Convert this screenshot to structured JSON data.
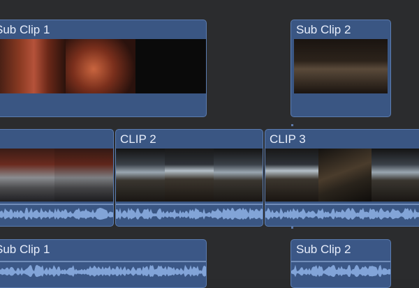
{
  "clips": {
    "top_left": {
      "title": "Sub Clip 1"
    },
    "top_right": {
      "title": "Sub Clip 2"
    },
    "main_1": {
      "title": ""
    },
    "main_2": {
      "title": "CLIP 2"
    },
    "main_3": {
      "title": "CLIP 3"
    },
    "bottom_left": {
      "title": "Sub Clip 1"
    },
    "bottom_right": {
      "title": "Sub Clip 2"
    }
  },
  "colors": {
    "clip_fill": "#3a5683",
    "clip_border": "#5b7cb0",
    "waveform": "#8fb2e6",
    "background": "#2b2c2e"
  }
}
